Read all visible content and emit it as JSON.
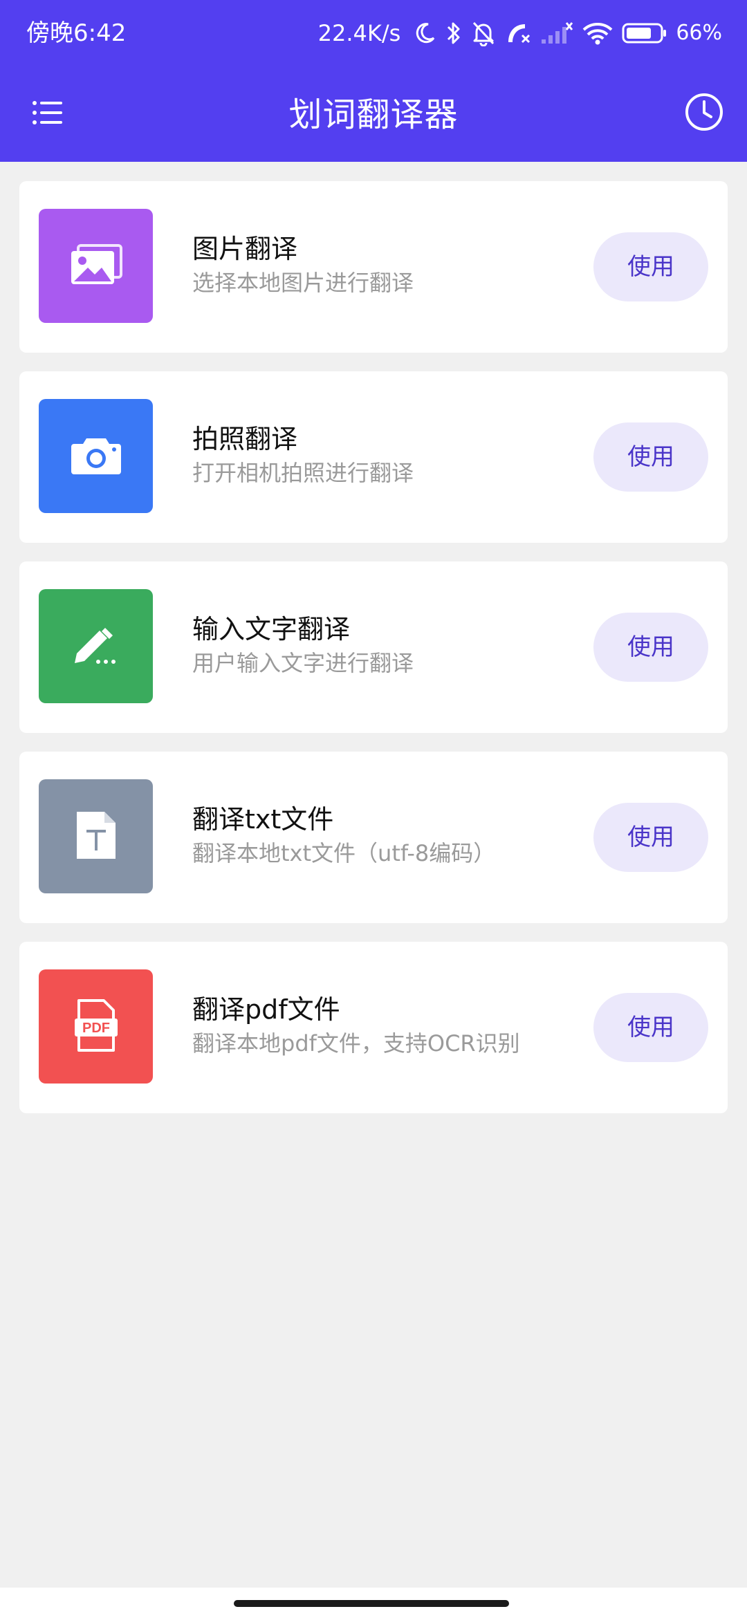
{
  "status_bar": {
    "time": "傍晚6:42",
    "net_speed": "22.4K/s",
    "battery": "66%",
    "icons": [
      "moon-icon",
      "bluetooth-icon",
      "bell-off-icon",
      "call-icon",
      "signal-icon",
      "wifi-icon",
      "battery-icon"
    ]
  },
  "app_bar": {
    "title": "划词翻译器",
    "menu_icon": "menu-icon",
    "history_icon": "clock-icon"
  },
  "features": [
    {
      "title": "图片翻译",
      "subtitle": "选择本地图片进行翻译",
      "button": "使用",
      "icon": "image-icon",
      "color": "#a95af0"
    },
    {
      "title": "拍照翻译",
      "subtitle": "打开相机拍照进行翻译",
      "button": "使用",
      "icon": "camera-icon",
      "color": "#3a78f5"
    },
    {
      "title": "输入文字翻译",
      "subtitle": "用户输入文字进行翻译",
      "button": "使用",
      "icon": "pencil-icon",
      "color": "#3aab5d"
    },
    {
      "title": "翻译txt文件",
      "subtitle": "翻译本地txt文件（utf-8编码）",
      "button": "使用",
      "icon": "text-file-icon",
      "color": "#8492a6"
    },
    {
      "title": "翻译pdf文件",
      "subtitle": "翻译本地pdf文件，支持OCR识别",
      "button": "使用",
      "icon": "pdf-file-icon",
      "color": "#f25151",
      "icon_label": "PDF"
    }
  ],
  "colors": {
    "primary": "#533ff0",
    "background": "#f0f0f0",
    "button_bg": "#ebe8fb",
    "button_text": "#4a35c9"
  }
}
